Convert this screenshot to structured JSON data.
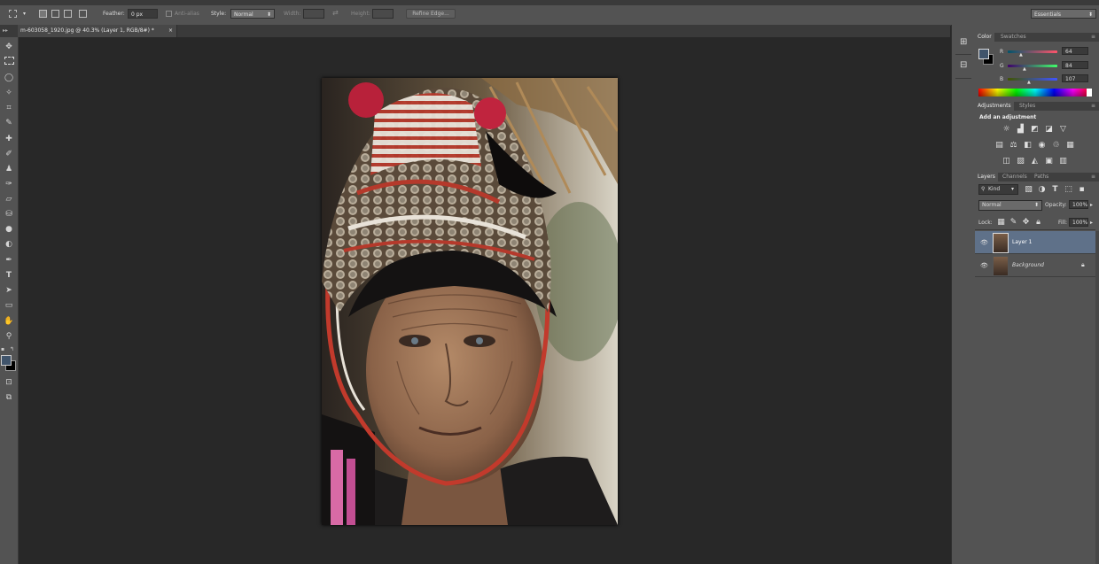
{
  "options_bar": {
    "feather_label": "Feather:",
    "feather_value": "0 px",
    "antialias_label": "Anti-alias",
    "style_label": "Style:",
    "style_value": "Normal",
    "width_label": "Width:",
    "height_label": "Height:",
    "refine_edge_label": "Refine Edge...",
    "workspace_value": "Essentials"
  },
  "document_tab": {
    "title": "m-603058_1920.jpg @ 40.3% (Layer 1, RGB/8#) *",
    "close_symbol": "×"
  },
  "color_panel": {
    "tabs": [
      "Color",
      "Swatches"
    ],
    "r_label": "R",
    "g_label": "G",
    "b_label": "B",
    "r_value": "64",
    "g_value": "84",
    "b_value": "107",
    "foreground_color": "#40546b",
    "background_color": "#000000"
  },
  "adjustments_panel": {
    "tabs": [
      "Adjustments",
      "Styles"
    ],
    "heading": "Add an adjustment",
    "row1_icons": [
      "brightness-icon",
      "levels-icon",
      "curves-icon",
      "exposure-icon",
      "vibrance-icon"
    ],
    "row2_icons": [
      "hue-saturation-icon",
      "color-balance-icon",
      "black-white-icon",
      "photo-filter-icon",
      "channel-mixer-icon",
      "color-lookup-icon"
    ],
    "row3_icons": [
      "invert-icon",
      "posterize-icon",
      "threshold-icon",
      "selective-color-icon",
      "gradient-map-icon"
    ]
  },
  "layers_panel": {
    "tabs": [
      "Layers",
      "Channels",
      "Paths"
    ],
    "filter_label": "Kind",
    "blend_mode": "Normal",
    "opacity_label": "Opacity:",
    "opacity_value": "100%",
    "lock_label": "Lock:",
    "fill_label": "Fill:",
    "fill_value": "100%",
    "layers": [
      {
        "name": "Layer 1",
        "selected": true
      },
      {
        "name": "Background",
        "selected": false,
        "locked": true
      }
    ]
  }
}
